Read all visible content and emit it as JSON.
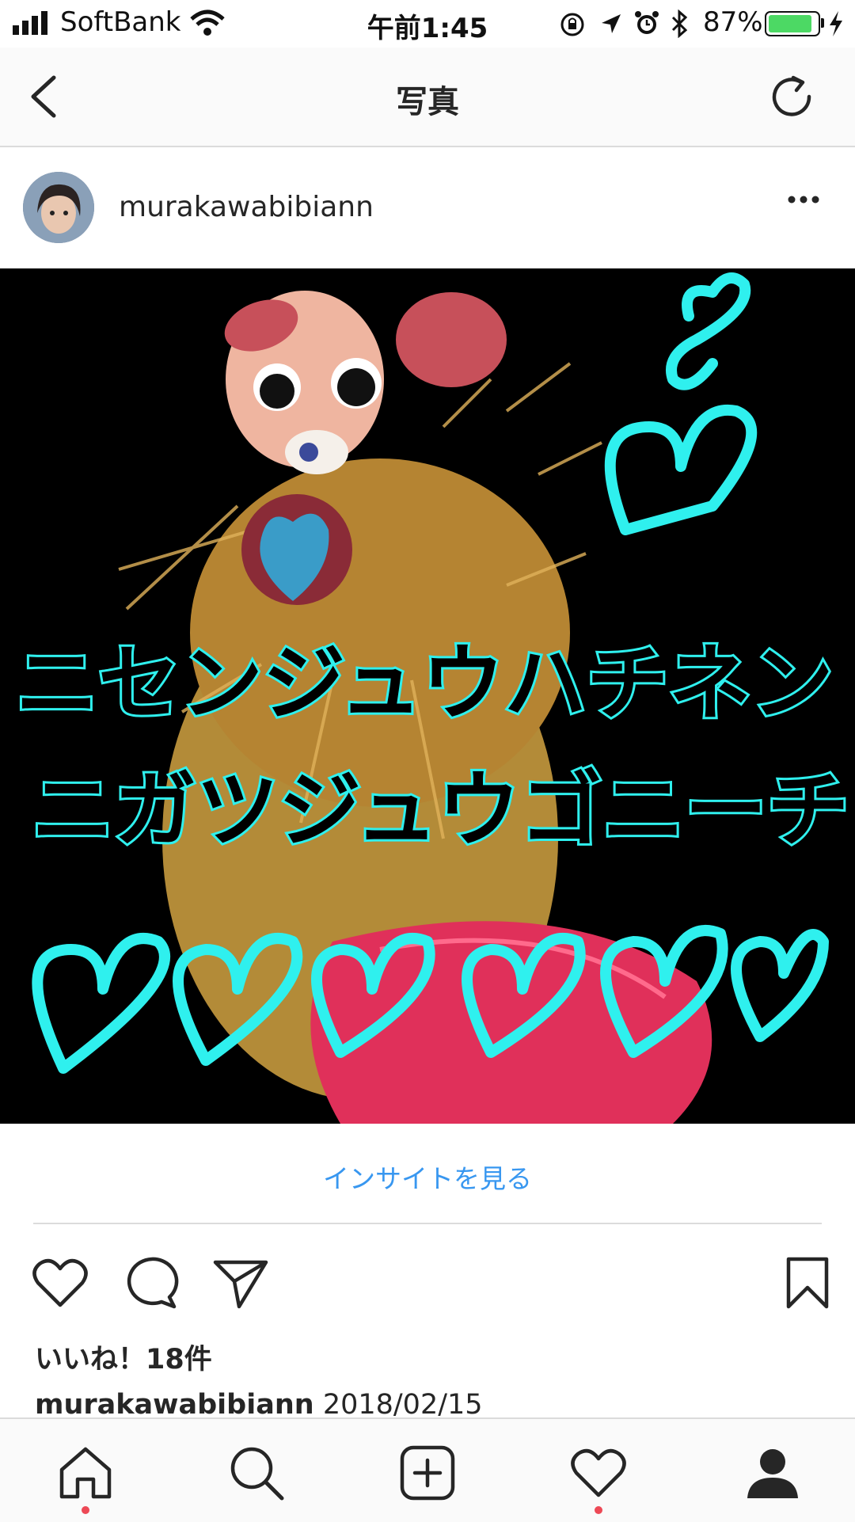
{
  "status_bar": {
    "carrier": "SoftBank",
    "time": "午前1:45",
    "battery": "87%",
    "battery_level": 0.87,
    "battery_color": "#4cd964"
  },
  "nav": {
    "title": "写真",
    "back_icon": "chevron-left-icon",
    "refresh_icon": "refresh-icon"
  },
  "post": {
    "username": "murakawabibiann",
    "photo": {
      "line1": "ニセンジュウハチネン",
      "line2": "ニガツジュウゴニーチ",
      "accent_color": "#2ff0ee"
    },
    "insights_link": "インサイトを見る",
    "likes": "いいね！18件",
    "caption_user": "murakawabibiann",
    "caption_text": "2018/02/15",
    "link_color": "#3897f0"
  },
  "tab_bar": {
    "items": [
      "home-icon",
      "search-icon",
      "add-post-icon",
      "activity-heart-icon",
      "profile-icon"
    ],
    "notification_color": "#ed4956"
  }
}
